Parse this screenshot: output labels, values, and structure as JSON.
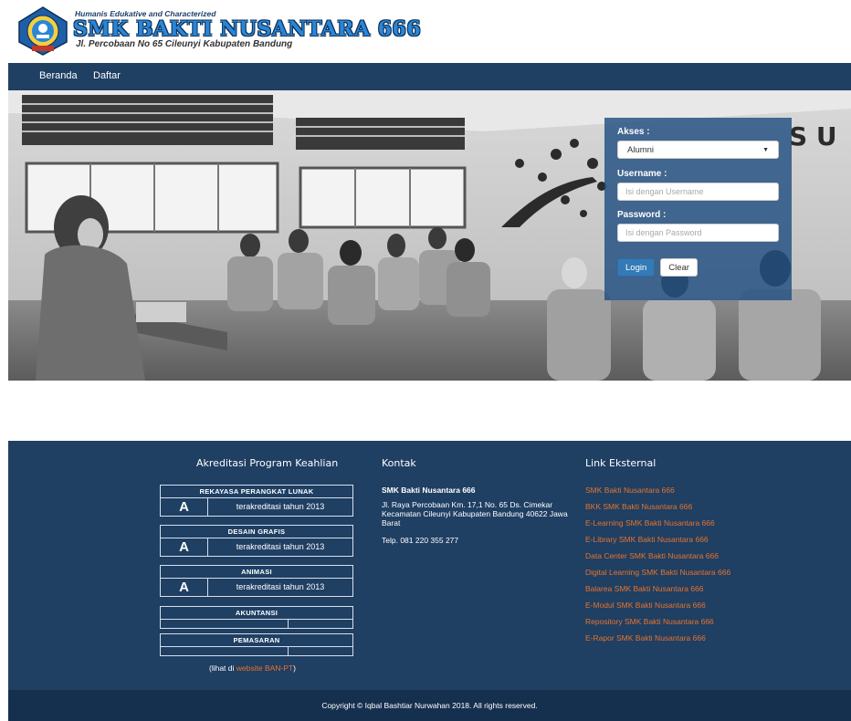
{
  "header": {
    "tagline": "Humanis Edukative and Characterized",
    "school_name": "SMK BAKTI NUSANTARA 666",
    "address": "Jl. Percobaan No 65 Cileunyi Kabupaten Bandung"
  },
  "nav": {
    "items": [
      {
        "label": "Beranda"
      },
      {
        "label": "Daftar"
      }
    ]
  },
  "login": {
    "akses_label": "Akses :",
    "akses_value": "Alumni",
    "username_label": "Username :",
    "username_placeholder": "Isi dengan Username",
    "password_label": "Password :",
    "password_placeholder": "Isi dengan Password",
    "login_button": "Login",
    "clear_button": "Clear"
  },
  "footer": {
    "akreditasi": {
      "title": "Akreditasi Program Keahlian",
      "programs": [
        {
          "name": "REKAYASA PERANGKAT LUNAK",
          "grade": "A",
          "status": "terakreditasi tahun 2013"
        },
        {
          "name": "DESAIN GRAFIS",
          "grade": "A",
          "status": "terakreditasi tahun 2013"
        },
        {
          "name": "ANIMASI",
          "grade": "A",
          "status": "terakreditasi tahun 2013"
        },
        {
          "name": "AKUNTANSI",
          "grade": "",
          "status": ""
        },
        {
          "name": "PEMASARAN",
          "grade": "",
          "status": ""
        }
      ],
      "note_prefix": "(lihat di ",
      "note_link": "website BAN-PT",
      "note_suffix": ")"
    },
    "kontak": {
      "title": "Kontak",
      "name": "SMK Bakti Nusantara 666",
      "address": "Jl. Raya Percobaan Km. 17,1 No. 65 Ds. Cimekar Kecamatan Cileunyi Kabupaten Bandung 40622 Jawa Barat",
      "phone": "Telp. 081 220 355 277"
    },
    "links": {
      "title": "Link Eksternal",
      "items": [
        {
          "label": "SMK Bakti Nusantara 666"
        },
        {
          "label": "BKK SMK Bakti Nusantara 666"
        },
        {
          "label": "E-Learning SMK Bakti Nusantara 666"
        },
        {
          "label": "E-Library SMK Bakti Nusantara 666"
        },
        {
          "label": "Data Center SMK Bakti Nusantara 666"
        },
        {
          "label": "Digital Learning SMK Bakti Nusantara 666"
        },
        {
          "label": "Balarea SMK Bakti Nusantara 666"
        },
        {
          "label": "E-Modul SMK Bakti Nusantara 666"
        },
        {
          "label": "Repository SMK Bakti Nusantara 666"
        },
        {
          "label": "E-Rapor SMK Bakti Nusantara 666"
        }
      ]
    },
    "copyright": "Copyright © Iqbal Bashtiar Nurwahan 2018. All rights reserved."
  },
  "colors": {
    "navy": "#1f3f63",
    "link_orange": "#e8732b",
    "button_blue": "#337ab7"
  }
}
